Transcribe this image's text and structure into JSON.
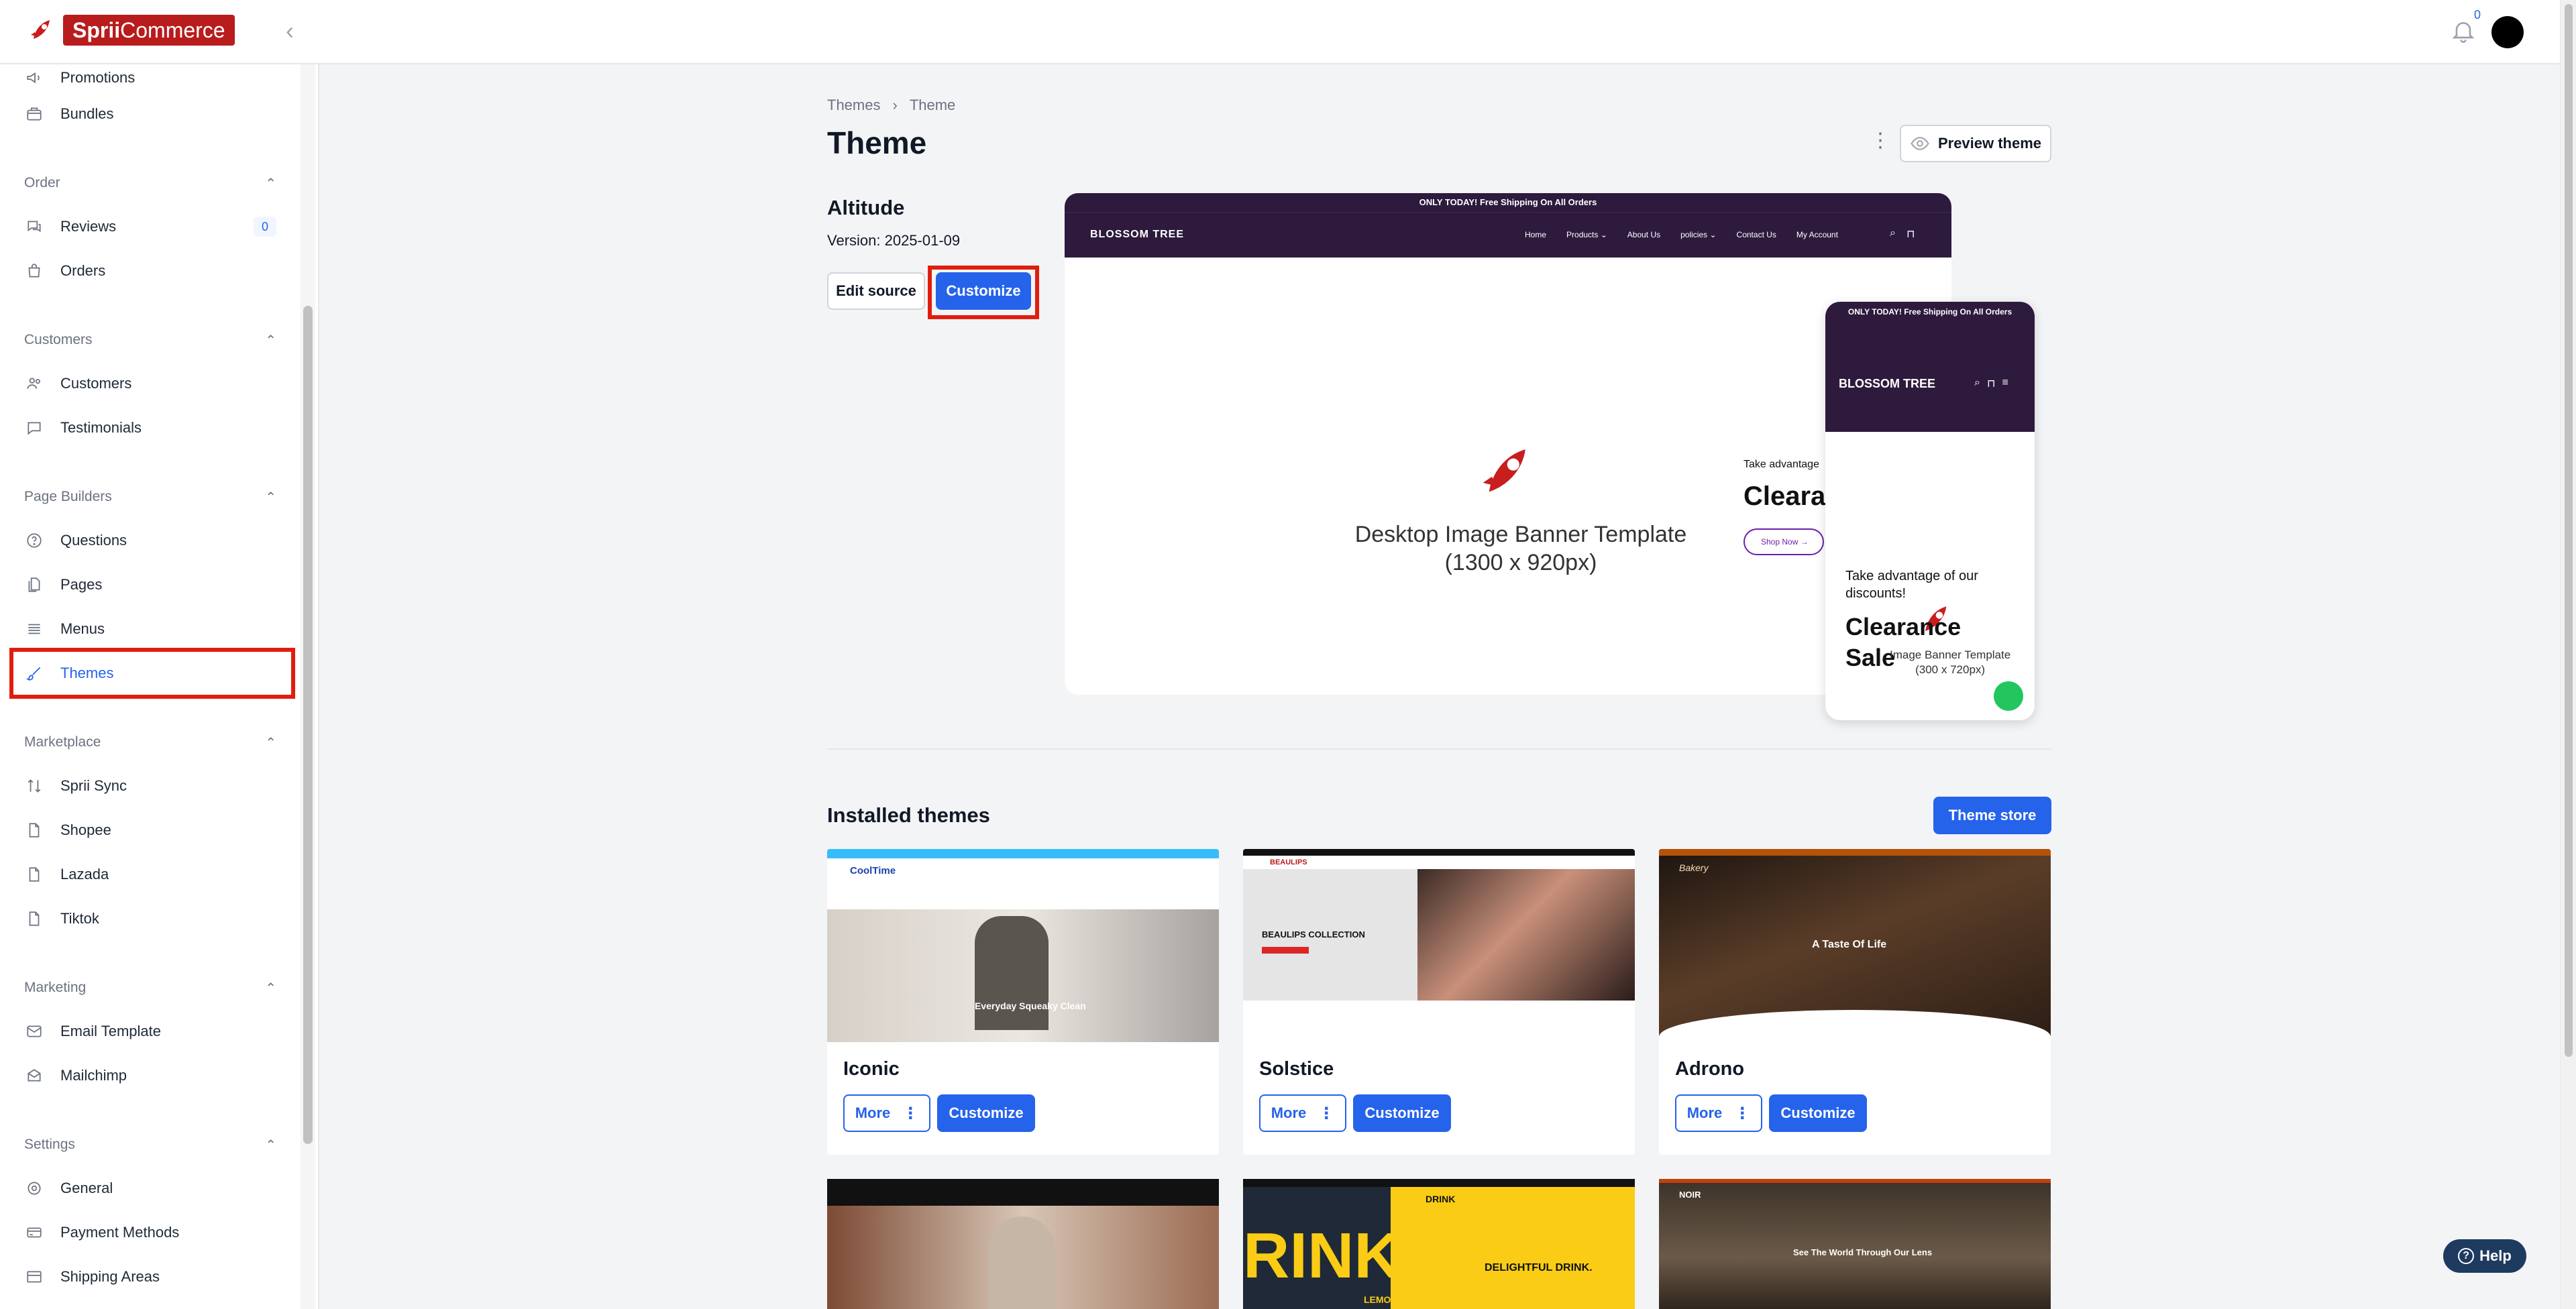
{
  "header": {
    "logo_strong": "Sprii",
    "logo_rest": "Commerce",
    "notification_count": "0"
  },
  "sidebar": {
    "top_items": [
      {
        "label": "Promotions",
        "icon": "megaphone-icon"
      },
      {
        "label": "Bundles",
        "icon": "box-icon"
      }
    ],
    "sections": [
      {
        "title": "Order",
        "items": [
          {
            "label": "Reviews",
            "icon": "chat-icon",
            "badge": "0"
          },
          {
            "label": "Orders",
            "icon": "bag-icon"
          }
        ]
      },
      {
        "title": "Customers",
        "items": [
          {
            "label": "Customers",
            "icon": "users-icon"
          },
          {
            "label": "Testimonials",
            "icon": "speech-icon"
          }
        ]
      },
      {
        "title": "Page Builders",
        "items": [
          {
            "label": "Questions",
            "icon": "question-icon"
          },
          {
            "label": "Pages",
            "icon": "pages-icon"
          },
          {
            "label": "Menus",
            "icon": "menu-icon"
          },
          {
            "label": "Themes",
            "icon": "brush-icon",
            "active": true
          }
        ]
      },
      {
        "title": "Marketplace",
        "items": [
          {
            "label": "Sprii Sync",
            "icon": "sync-icon"
          },
          {
            "label": "Shopee",
            "icon": "file-icon"
          },
          {
            "label": "Lazada",
            "icon": "file-icon"
          },
          {
            "label": "Tiktok",
            "icon": "file-icon"
          }
        ]
      },
      {
        "title": "Marketing",
        "items": [
          {
            "label": "Email Template",
            "icon": "mail-icon"
          },
          {
            "label": "Mailchimp",
            "icon": "mailchimp-icon"
          }
        ]
      },
      {
        "title": "Settings",
        "items": [
          {
            "label": "General",
            "icon": "gear-icon"
          },
          {
            "label": "Payment Methods",
            "icon": "card-icon"
          },
          {
            "label": "Shipping Areas",
            "icon": "truck-icon"
          }
        ]
      }
    ]
  },
  "breadcrumb": {
    "parent": "Themes",
    "current": "Theme"
  },
  "page": {
    "title": "Theme",
    "preview_label": "Preview theme"
  },
  "current_theme": {
    "name": "Altitude",
    "version": "Version: 2025-01-09",
    "edit_label": "Edit source",
    "customize_label": "Customize"
  },
  "desktop_preview": {
    "announcement": "ONLY TODAY! Free Shipping On All Orders",
    "brand": "BLOSSOM TREE",
    "nav_links": [
      "Home",
      "Products ⌄",
      "About Us",
      "policies ⌄",
      "Contact Us",
      "My Account"
    ],
    "banner_line1": "Desktop Image Banner Template",
    "banner_line2": "(1300 x 920px)",
    "side_small": "Take advantage",
    "side_big": "Cleara",
    "shop_label": "Shop Now  →"
  },
  "mobile_preview": {
    "announcement": "ONLY TODAY! Free Shipping On All Orders",
    "brand": "BLOSSOM TREE",
    "small": "Take advantage of our discounts!",
    "big": "Clearance Sale",
    "sub1": "Image Banner Template",
    "sub2": "(300 x 720px)"
  },
  "installed": {
    "title": "Installed themes",
    "store_label": "Theme store",
    "more_label": "More",
    "customize_label": "Customize",
    "themes": [
      {
        "name": "Iconic"
      },
      {
        "name": "Solstice"
      },
      {
        "name": "Adrono"
      }
    ],
    "thumb_text": {
      "iconic_brand": "CoolTime",
      "iconic_banner": "Everyday Squeaky Clean",
      "solstice_brand": "BEAULIPS",
      "solstice_banner": "BEAULIPS COLLECTION",
      "adrono_brand": "Bakery",
      "adrono_banner": "A Taste Of Life",
      "row2_drink": "DELIGHTFUL DRINK.",
      "row2_drink_big": "RINK",
      "row2_drink_lemon": "LEMON",
      "row2_drink_brand": "DRINK",
      "row2_noir": "NOIR",
      "row2_noir_tag": "See The World Through Our Lens"
    }
  },
  "help_label": "Help"
}
